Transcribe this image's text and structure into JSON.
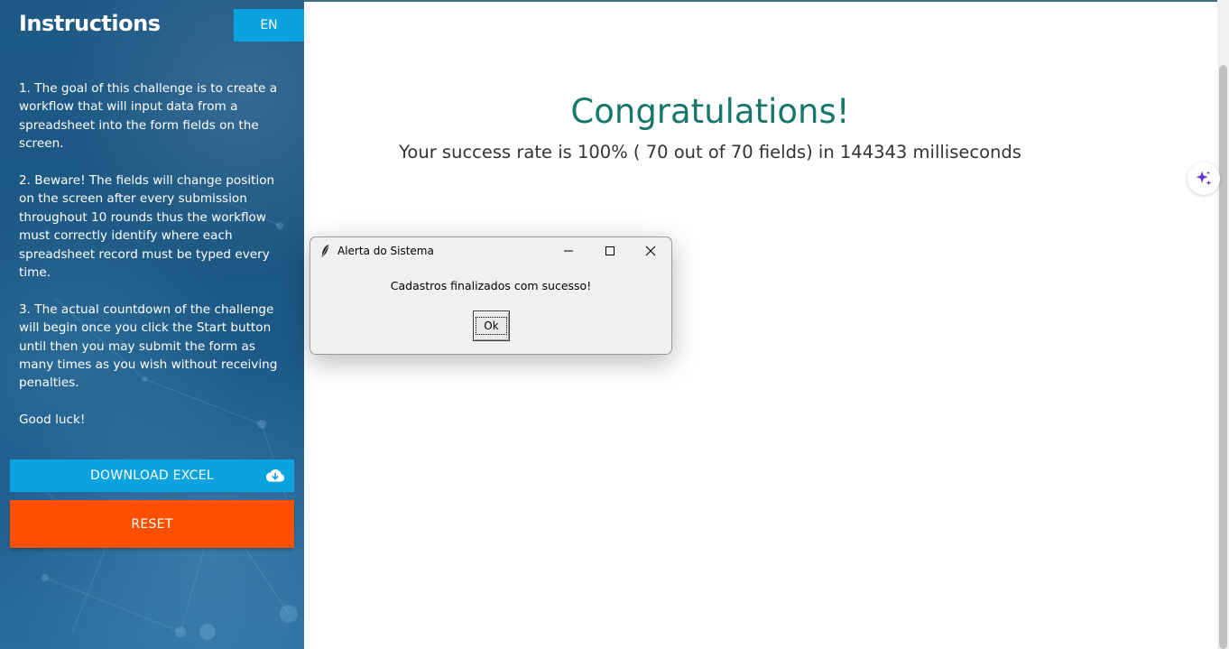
{
  "sidebar": {
    "title": "Instructions",
    "language_button": "EN",
    "instructions": [
      "1. The goal of this challenge is to create a workflow that will input data from a spreadsheet into the form fields on the screen.",
      "2. Beware! The fields will change position on the screen after every submission throughout 10 rounds thus the workflow must correctly identify where each spreadsheet record must be typed every time.",
      "3. The actual countdown of the challenge will begin once you click the Start button until then you may submit the form as many times as you wish without receiving penalties.",
      "Good luck!"
    ],
    "download_button": "DOWNLOAD EXCEL",
    "download_icon": "cloud-download-icon",
    "reset_button": "RESET"
  },
  "main": {
    "heading": "Congratulations!",
    "result_text": "Your success rate is 100% ( 70 out of 70 fields) in 144343 milliseconds"
  },
  "dialog": {
    "title": "Alerta do Sistema",
    "message": "Cadastros finalizados com sucesso!",
    "ok_button": "Ok",
    "icons": [
      "feather-icon",
      "minimize-icon",
      "maximize-icon",
      "close-icon"
    ]
  },
  "colors": {
    "sidebar_bg": "#1b5782",
    "accent_blue": "#0aa3e0",
    "reset_orange": "#fe5000",
    "heading_green": "#17776a"
  }
}
